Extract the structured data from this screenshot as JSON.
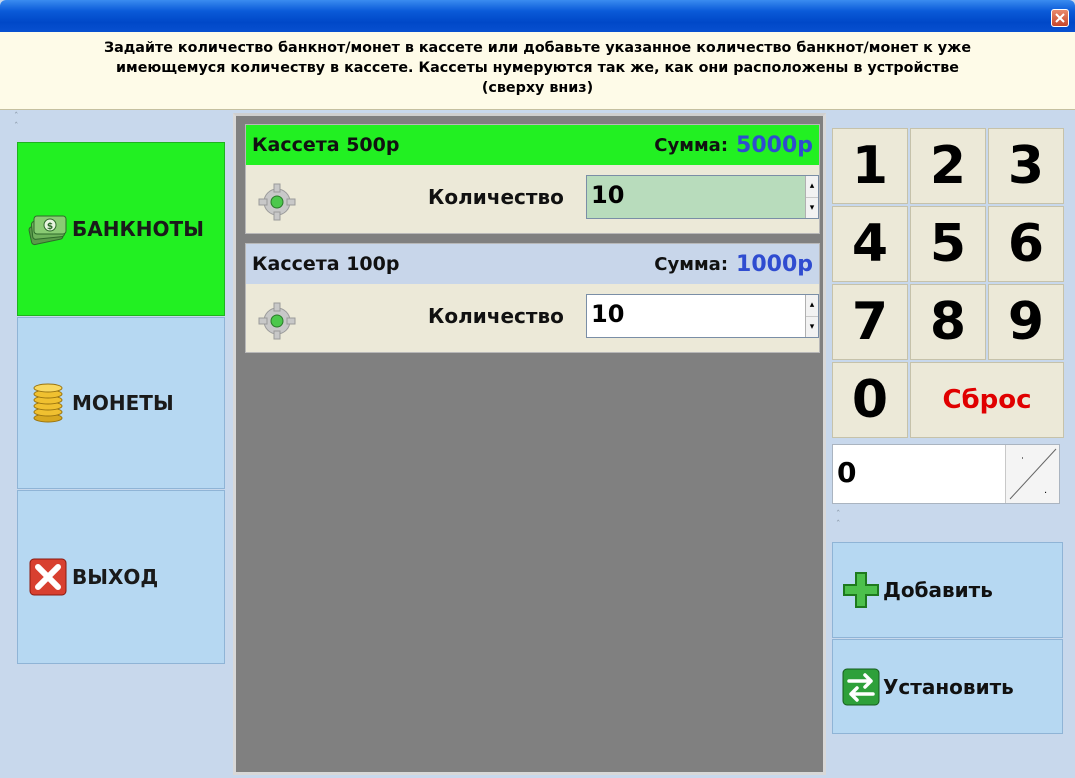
{
  "instructions": {
    "line1": "Задайте количество банкнот/монет в кассете или добавьте указанное количество банкнот/монет к уже",
    "line2": "имеющемуся количеству в кассете. Кассеты нумеруются так же, как они расположены в устройстве",
    "line3": "(сверху вниз)"
  },
  "menu": {
    "items": [
      {
        "label": "БАНКНОТЫ",
        "icon": "banknotes-icon",
        "active": true
      },
      {
        "label": "МОНЕТЫ",
        "icon": "coins-icon",
        "active": false
      },
      {
        "label": "ВЫХОД",
        "icon": "exit-icon",
        "active": false
      }
    ]
  },
  "cassettes": [
    {
      "title": "Кассета 500р",
      "sum_label": "Сумма:",
      "sum_value": "5000р",
      "qty_label": "Количество",
      "qty_value": "10",
      "header_color": "#22f022",
      "field_color": "#b8dcbc"
    },
    {
      "title": "Кассета 100р",
      "sum_label": "Сумма:",
      "sum_value": "1000р",
      "qty_label": "Количество",
      "qty_value": "10",
      "header_color": "#c8d6ea",
      "field_color": "#ffffff"
    }
  ],
  "keypad": {
    "keys": [
      "1",
      "2",
      "3",
      "4",
      "5",
      "6",
      "7",
      "8",
      "9",
      "0"
    ],
    "reset_label": "Сброс",
    "value": "0"
  },
  "actions": {
    "add_label": "Добавить",
    "set_label": "Установить"
  },
  "colors": {
    "active_menu": "#22f022",
    "menu_bg": "#b6d8f2",
    "sum_value": "#2f4cd0",
    "reset_text": "#e00000"
  }
}
